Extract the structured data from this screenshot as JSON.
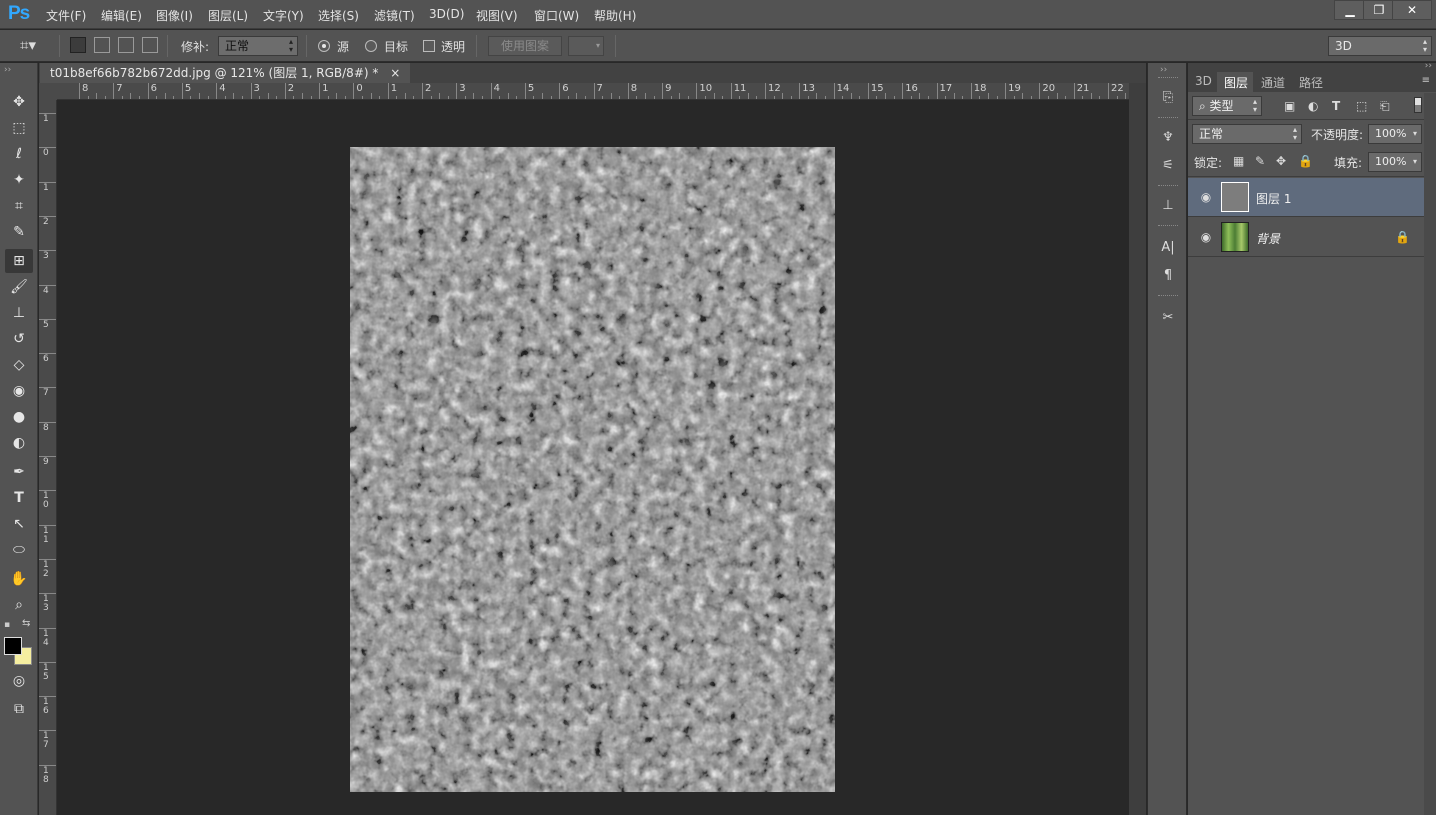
{
  "app": {
    "logo": "Ps",
    "menu": [
      "文件(F)",
      "编辑(E)",
      "图像(I)",
      "图层(L)",
      "文字(Y)",
      "选择(S)",
      "滤镜(T)",
      "3D(D)",
      "视图(V)",
      "窗口(W)",
      "帮助(H)"
    ],
    "window_buttons": [
      "minimize",
      "restore",
      "close"
    ]
  },
  "options": {
    "patch_label": "修补:",
    "patch_mode": "正常",
    "radio_source": "源",
    "radio_target": "目标",
    "transparent_label": "透明",
    "use_pattern": "使用图案",
    "workspace": "3D"
  },
  "document": {
    "tab_title": "t01b8ef66b782b672dd.jpg @ 121% (图层 1, RGB/8#) *",
    "close_glyph": "×",
    "ruler_top": [
      "8",
      "7",
      "6",
      "5",
      "4",
      "3",
      "2",
      "1",
      "0",
      "1",
      "2",
      "3",
      "4",
      "5",
      "6",
      "7",
      "8",
      "9",
      "10",
      "11",
      "12",
      "13",
      "14",
      "15",
      "16",
      "17",
      "18",
      "19",
      "20",
      "21",
      "22"
    ],
    "ruler_left": [
      "1",
      "0",
      "1",
      "2",
      "3",
      "4",
      "5",
      "6",
      "7",
      "8",
      "9",
      "10",
      "11",
      "12",
      "13",
      "14",
      "15",
      "16",
      "17",
      "18"
    ]
  },
  "layers_panel": {
    "tabs": [
      "3D",
      "图层",
      "通道",
      "路径"
    ],
    "active_tab": "图层",
    "filter_kind": "类型",
    "blend_mode": "正常",
    "opacity_label": "不透明度:",
    "opacity_value": "100%",
    "lock_label": "锁定:",
    "fill_label": "填充:",
    "fill_value": "100%",
    "layers": [
      {
        "name": "图层 1",
        "selected": true
      },
      {
        "name": "背景",
        "selected": false,
        "locked": true
      }
    ]
  },
  "colors": {
    "foreground": "#000000",
    "background": "#f5eea0",
    "selection": "#5f6b7d"
  }
}
